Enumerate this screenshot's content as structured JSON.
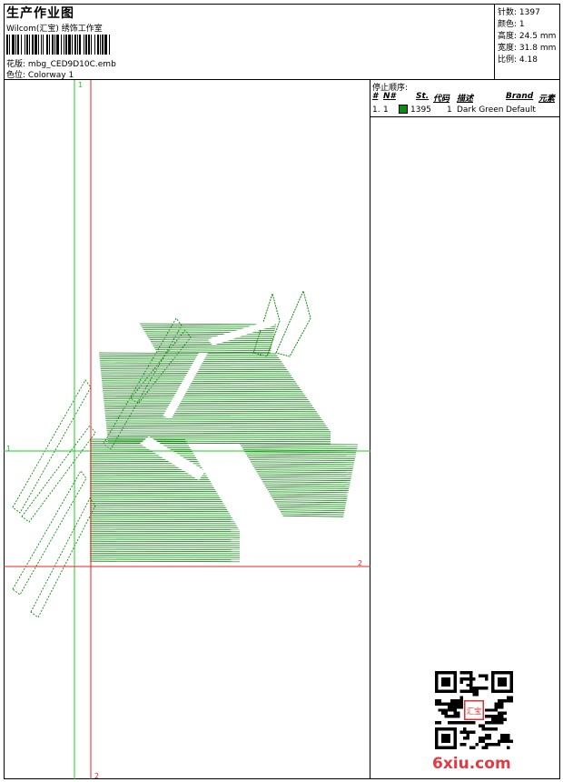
{
  "header": {
    "title": "生产作业图",
    "studio": "Wilcom(汇宝) 绣饰工作室",
    "design_file_label": "花版:",
    "design_file": "mbg_CED9D10C.emb",
    "colorway_label": "色位:",
    "colorway": "Colorway 1"
  },
  "specs": [
    {
      "label": "针数:",
      "value": "1397"
    },
    {
      "label": "颜色:",
      "value": "1"
    },
    {
      "label": "高度:",
      "value": "24.5 mm"
    },
    {
      "label": "宽度:",
      "value": "31.8 mm"
    },
    {
      "label": "比例:",
      "value": "4.18"
    }
  ],
  "design": {
    "guide_labels": {
      "green_v": "1",
      "green_h": "1",
      "red_h": "2",
      "red_v": "2"
    },
    "thread_color": "#0f8a0f",
    "guide_green": "#22cc22",
    "guide_red": "#ee2222"
  },
  "stop_sequence": {
    "title": "停止顺序:",
    "columns": [
      "#",
      "N#",
      "St.",
      "代码",
      "描述",
      "Brand",
      "元素"
    ],
    "rows": [
      {
        "num": "1.",
        "n": "1",
        "stitches": "1395",
        "code": "1",
        "description": "Dark Green",
        "brand": "Default",
        "element": ""
      }
    ],
    "swatch_color": "#0f8a0f"
  },
  "watermark": {
    "text": "6xiu.com",
    "stamp_text": "汇宝"
  }
}
